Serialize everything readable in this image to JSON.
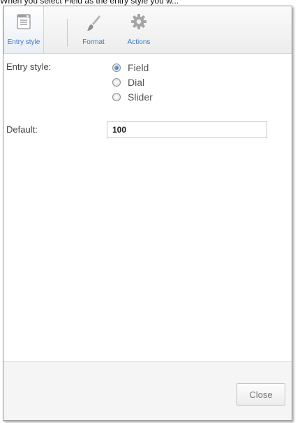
{
  "caption": "When you select Field as the entry style you w...",
  "toolbar": {
    "items": [
      {
        "label": "Entry style",
        "icon": "entry-style-icon",
        "active": true
      },
      {
        "label": "Format",
        "icon": "paintbrush-icon",
        "active": false
      },
      {
        "label": "Actions",
        "icon": "gear-icon",
        "active": false
      }
    ]
  },
  "form": {
    "entry_style_label": "Entry style:",
    "options": [
      {
        "label": "Field",
        "checked": true
      },
      {
        "label": "Dial",
        "checked": false
      },
      {
        "label": "Slider",
        "checked": false
      }
    ],
    "default_label": "Default:",
    "default_value": "100"
  },
  "footer": {
    "close_label": "Close"
  },
  "colors": {
    "accent": "#3b78c4",
    "radio_selected": "#1f5fb5",
    "border": "#9a9a9a"
  }
}
